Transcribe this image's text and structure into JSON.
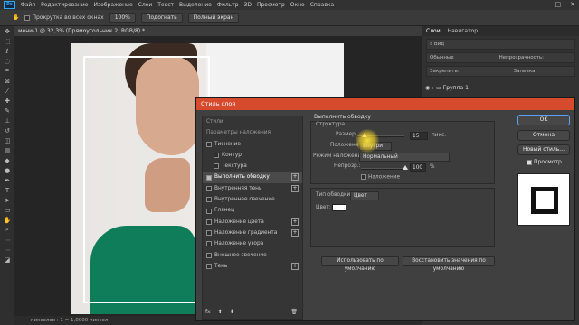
{
  "menubar": {
    "logo": "Ps",
    "items": [
      "Файл",
      "Редактирование",
      "Изображение",
      "Слои",
      "Текст",
      "Выделение",
      "Фильтр",
      "3D",
      "Просмотр",
      "Окно",
      "Справка"
    ],
    "controls": [
      "—",
      "□",
      "✕"
    ]
  },
  "options": {
    "scroll_all": "Прокрутка во всех окнах",
    "zoom": "100%",
    "fit": "Подогнать",
    "fullscreen": "Полный экран"
  },
  "document": {
    "tab": "мени-1 @ 32,3% (Прямоугольник 2, RGB/8) *",
    "status": "пикселов : 1 = 1,0000 пиксел"
  },
  "right_panel": {
    "tabs": [
      "Слои",
      "Навигатор"
    ],
    "search": "Вид",
    "blend": "Обычные",
    "opacity_label": "Непрозрачность:",
    "lock_label": "Закрепить:",
    "fill_label": "Заливка:",
    "group": "Группа 1"
  },
  "dialog": {
    "title": "Стиль слоя",
    "styles_header": "Стили",
    "blend_options": "Параметры наложения",
    "effects": [
      {
        "label": "Тиснение",
        "checked": false,
        "plus": false,
        "sub": false
      },
      {
        "label": "Контур",
        "checked": false,
        "plus": false,
        "sub": true
      },
      {
        "label": "Текстура",
        "checked": false,
        "plus": false,
        "sub": true
      },
      {
        "label": "Выполнить обводку",
        "checked": true,
        "plus": true,
        "sub": false,
        "selected": true
      },
      {
        "label": "Внутренняя тень",
        "checked": false,
        "plus": true,
        "sub": false
      },
      {
        "label": "Внутреннее свечение",
        "checked": false,
        "plus": false,
        "sub": false
      },
      {
        "label": "Глянец",
        "checked": false,
        "plus": false,
        "sub": false
      },
      {
        "label": "Наложение цвета",
        "checked": false,
        "plus": true,
        "sub": false
      },
      {
        "label": "Наложение градиента",
        "checked": false,
        "plus": true,
        "sub": false
      },
      {
        "label": "Наложение узора",
        "checked": false,
        "plus": false,
        "sub": false
      },
      {
        "label": "Внешнее свечение",
        "checked": false,
        "plus": false,
        "sub": false
      },
      {
        "label": "Тень",
        "checked": false,
        "plus": true,
        "sub": false
      }
    ],
    "fx": "fx",
    "section": "Выполнить обводку",
    "structure": "Структура",
    "size_label": "Размер:",
    "size_value": "15",
    "size_unit": "пикс.",
    "position_label": "Положение:",
    "position_value": "Внутри",
    "blend_label": "Режим наложения:",
    "blend_value": "Нормальный",
    "opacity_label": "Непрозр.:",
    "opacity_value": "100",
    "opacity_unit": "%",
    "overprint": "Наложение",
    "fill_type_label": "Тип обводки:",
    "fill_type_value": "Цвет",
    "color_label": "Цвет:",
    "make_default": "Использовать по умолчанию",
    "reset_default": "Восстановить значения по умолчанию",
    "ok": "OK",
    "cancel": "Отмена",
    "new_style": "Новый стиль...",
    "preview": "Просмотр"
  }
}
